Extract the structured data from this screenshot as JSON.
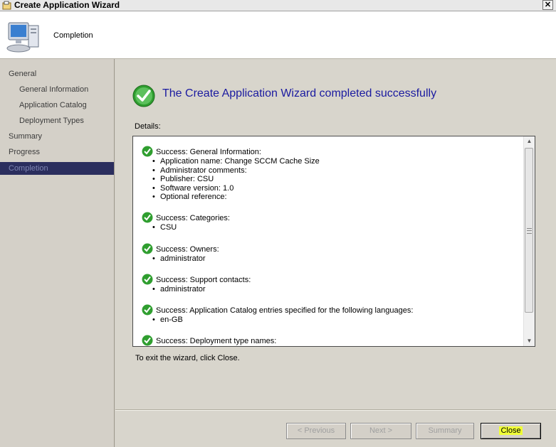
{
  "window": {
    "title": "Create Application Wizard",
    "close_glyph": "✕"
  },
  "header": {
    "title": "Completion",
    "icon": "computer-icon"
  },
  "sidebar": {
    "items": [
      {
        "label": "General",
        "level": 1,
        "active": false
      },
      {
        "label": "General Information",
        "level": 2,
        "active": false
      },
      {
        "label": "Application Catalog",
        "level": 2,
        "active": false
      },
      {
        "label": "Deployment Types",
        "level": 2,
        "active": false
      },
      {
        "label": "Summary",
        "level": 1,
        "active": false
      },
      {
        "label": "Progress",
        "level": 1,
        "active": false
      },
      {
        "label": "Completion",
        "level": 1,
        "active": true
      }
    ]
  },
  "main": {
    "heading": "The Create Application Wizard completed successfully",
    "details_label": "Details:",
    "sections": [
      {
        "title": "Success: General Information:",
        "items": [
          "Application name: Change SCCM Cache Size",
          "Administrator comments:",
          "Publisher: CSU",
          "Software version: 1.0",
          "Optional reference:"
        ]
      },
      {
        "title": "Success: Categories:",
        "items": [
          "CSU"
        ]
      },
      {
        "title": "Success: Owners:",
        "items": [
          "administrator"
        ]
      },
      {
        "title": "Success: Support contacts:",
        "items": [
          "administrator"
        ]
      },
      {
        "title": "Success: Application Catalog entries specified for the following languages:",
        "items": [
          "en-GB"
        ]
      },
      {
        "title": "Success: Deployment type names:",
        "items": []
      }
    ],
    "exit_text": "To exit the wizard, click Close."
  },
  "buttons": {
    "previous": "< Previous",
    "next": "Next >",
    "summary": "Summary",
    "close": "Close"
  }
}
